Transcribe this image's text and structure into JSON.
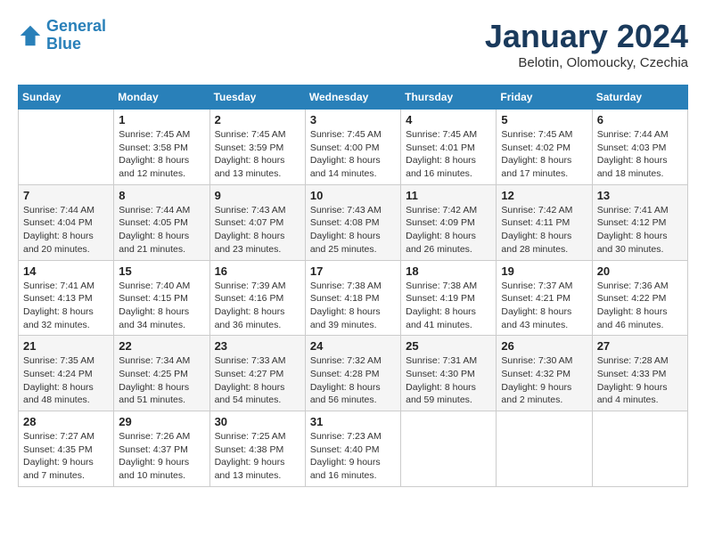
{
  "header": {
    "logo_line1": "General",
    "logo_line2": "Blue",
    "month": "January 2024",
    "location": "Belotin, Olomoucky, Czechia"
  },
  "weekdays": [
    "Sunday",
    "Monday",
    "Tuesday",
    "Wednesday",
    "Thursday",
    "Friday",
    "Saturday"
  ],
  "weeks": [
    [
      {
        "date": "",
        "sunrise": "",
        "sunset": "",
        "daylight": ""
      },
      {
        "date": "1",
        "sunrise": "Sunrise: 7:45 AM",
        "sunset": "Sunset: 3:58 PM",
        "daylight": "Daylight: 8 hours and 12 minutes."
      },
      {
        "date": "2",
        "sunrise": "Sunrise: 7:45 AM",
        "sunset": "Sunset: 3:59 PM",
        "daylight": "Daylight: 8 hours and 13 minutes."
      },
      {
        "date": "3",
        "sunrise": "Sunrise: 7:45 AM",
        "sunset": "Sunset: 4:00 PM",
        "daylight": "Daylight: 8 hours and 14 minutes."
      },
      {
        "date": "4",
        "sunrise": "Sunrise: 7:45 AM",
        "sunset": "Sunset: 4:01 PM",
        "daylight": "Daylight: 8 hours and 16 minutes."
      },
      {
        "date": "5",
        "sunrise": "Sunrise: 7:45 AM",
        "sunset": "Sunset: 4:02 PM",
        "daylight": "Daylight: 8 hours and 17 minutes."
      },
      {
        "date": "6",
        "sunrise": "Sunrise: 7:44 AM",
        "sunset": "Sunset: 4:03 PM",
        "daylight": "Daylight: 8 hours and 18 minutes."
      }
    ],
    [
      {
        "date": "7",
        "sunrise": "Sunrise: 7:44 AM",
        "sunset": "Sunset: 4:04 PM",
        "daylight": "Daylight: 8 hours and 20 minutes."
      },
      {
        "date": "8",
        "sunrise": "Sunrise: 7:44 AM",
        "sunset": "Sunset: 4:05 PM",
        "daylight": "Daylight: 8 hours and 21 minutes."
      },
      {
        "date": "9",
        "sunrise": "Sunrise: 7:43 AM",
        "sunset": "Sunset: 4:07 PM",
        "daylight": "Daylight: 8 hours and 23 minutes."
      },
      {
        "date": "10",
        "sunrise": "Sunrise: 7:43 AM",
        "sunset": "Sunset: 4:08 PM",
        "daylight": "Daylight: 8 hours and 25 minutes."
      },
      {
        "date": "11",
        "sunrise": "Sunrise: 7:42 AM",
        "sunset": "Sunset: 4:09 PM",
        "daylight": "Daylight: 8 hours and 26 minutes."
      },
      {
        "date": "12",
        "sunrise": "Sunrise: 7:42 AM",
        "sunset": "Sunset: 4:11 PM",
        "daylight": "Daylight: 8 hours and 28 minutes."
      },
      {
        "date": "13",
        "sunrise": "Sunrise: 7:41 AM",
        "sunset": "Sunset: 4:12 PM",
        "daylight": "Daylight: 8 hours and 30 minutes."
      }
    ],
    [
      {
        "date": "14",
        "sunrise": "Sunrise: 7:41 AM",
        "sunset": "Sunset: 4:13 PM",
        "daylight": "Daylight: 8 hours and 32 minutes."
      },
      {
        "date": "15",
        "sunrise": "Sunrise: 7:40 AM",
        "sunset": "Sunset: 4:15 PM",
        "daylight": "Daylight: 8 hours and 34 minutes."
      },
      {
        "date": "16",
        "sunrise": "Sunrise: 7:39 AM",
        "sunset": "Sunset: 4:16 PM",
        "daylight": "Daylight: 8 hours and 36 minutes."
      },
      {
        "date": "17",
        "sunrise": "Sunrise: 7:38 AM",
        "sunset": "Sunset: 4:18 PM",
        "daylight": "Daylight: 8 hours and 39 minutes."
      },
      {
        "date": "18",
        "sunrise": "Sunrise: 7:38 AM",
        "sunset": "Sunset: 4:19 PM",
        "daylight": "Daylight: 8 hours and 41 minutes."
      },
      {
        "date": "19",
        "sunrise": "Sunrise: 7:37 AM",
        "sunset": "Sunset: 4:21 PM",
        "daylight": "Daylight: 8 hours and 43 minutes."
      },
      {
        "date": "20",
        "sunrise": "Sunrise: 7:36 AM",
        "sunset": "Sunset: 4:22 PM",
        "daylight": "Daylight: 8 hours and 46 minutes."
      }
    ],
    [
      {
        "date": "21",
        "sunrise": "Sunrise: 7:35 AM",
        "sunset": "Sunset: 4:24 PM",
        "daylight": "Daylight: 8 hours and 48 minutes."
      },
      {
        "date": "22",
        "sunrise": "Sunrise: 7:34 AM",
        "sunset": "Sunset: 4:25 PM",
        "daylight": "Daylight: 8 hours and 51 minutes."
      },
      {
        "date": "23",
        "sunrise": "Sunrise: 7:33 AM",
        "sunset": "Sunset: 4:27 PM",
        "daylight": "Daylight: 8 hours and 54 minutes."
      },
      {
        "date": "24",
        "sunrise": "Sunrise: 7:32 AM",
        "sunset": "Sunset: 4:28 PM",
        "daylight": "Daylight: 8 hours and 56 minutes."
      },
      {
        "date": "25",
        "sunrise": "Sunrise: 7:31 AM",
        "sunset": "Sunset: 4:30 PM",
        "daylight": "Daylight: 8 hours and 59 minutes."
      },
      {
        "date": "26",
        "sunrise": "Sunrise: 7:30 AM",
        "sunset": "Sunset: 4:32 PM",
        "daylight": "Daylight: 9 hours and 2 minutes."
      },
      {
        "date": "27",
        "sunrise": "Sunrise: 7:28 AM",
        "sunset": "Sunset: 4:33 PM",
        "daylight": "Daylight: 9 hours and 4 minutes."
      }
    ],
    [
      {
        "date": "28",
        "sunrise": "Sunrise: 7:27 AM",
        "sunset": "Sunset: 4:35 PM",
        "daylight": "Daylight: 9 hours and 7 minutes."
      },
      {
        "date": "29",
        "sunrise": "Sunrise: 7:26 AM",
        "sunset": "Sunset: 4:37 PM",
        "daylight": "Daylight: 9 hours and 10 minutes."
      },
      {
        "date": "30",
        "sunrise": "Sunrise: 7:25 AM",
        "sunset": "Sunset: 4:38 PM",
        "daylight": "Daylight: 9 hours and 13 minutes."
      },
      {
        "date": "31",
        "sunrise": "Sunrise: 7:23 AM",
        "sunset": "Sunset: 4:40 PM",
        "daylight": "Daylight: 9 hours and 16 minutes."
      },
      {
        "date": "",
        "sunrise": "",
        "sunset": "",
        "daylight": ""
      },
      {
        "date": "",
        "sunrise": "",
        "sunset": "",
        "daylight": ""
      },
      {
        "date": "",
        "sunrise": "",
        "sunset": "",
        "daylight": ""
      }
    ]
  ]
}
